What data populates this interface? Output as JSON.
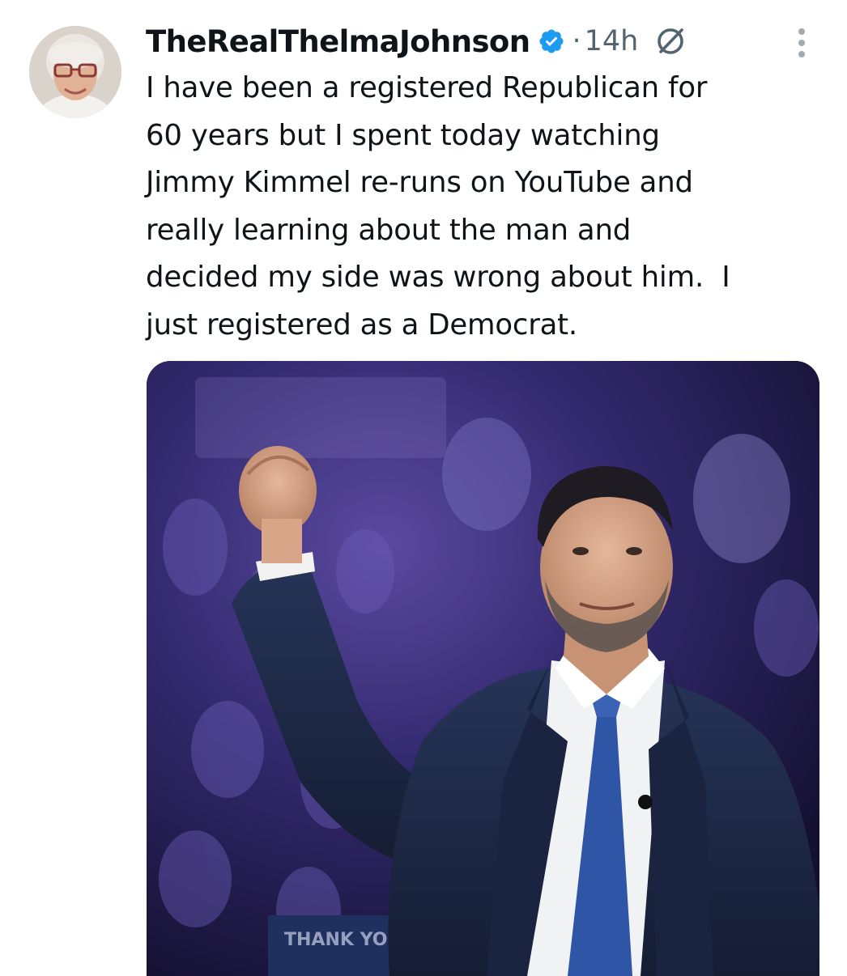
{
  "post": {
    "author": {
      "display_name": "TheRealThelmaJohnson",
      "verified": true,
      "avatar_icon": "avatar-elderly-woman"
    },
    "separator": "·",
    "timestamp": "14h",
    "header_icons": [
      "verified-badge-icon",
      "grok-icon",
      "more-options-icon"
    ],
    "text": "I have been a registered Republican for\n60 years but I spent today watching\nJimmy Kimmel re-runs on YouTube and\nreally learning about the man and\ndecided my side was wrong about him.  I\njust registered as a Democrat.",
    "media": {
      "type": "photo",
      "sign_text": "THANK YOU"
    }
  },
  "colors": {
    "verified_blue": "#1d9bf0",
    "muted_text": "#536471",
    "primary_text": "#0f1419",
    "suit_navy": "#1c2740",
    "tie_blue": "#2f55a6"
  }
}
